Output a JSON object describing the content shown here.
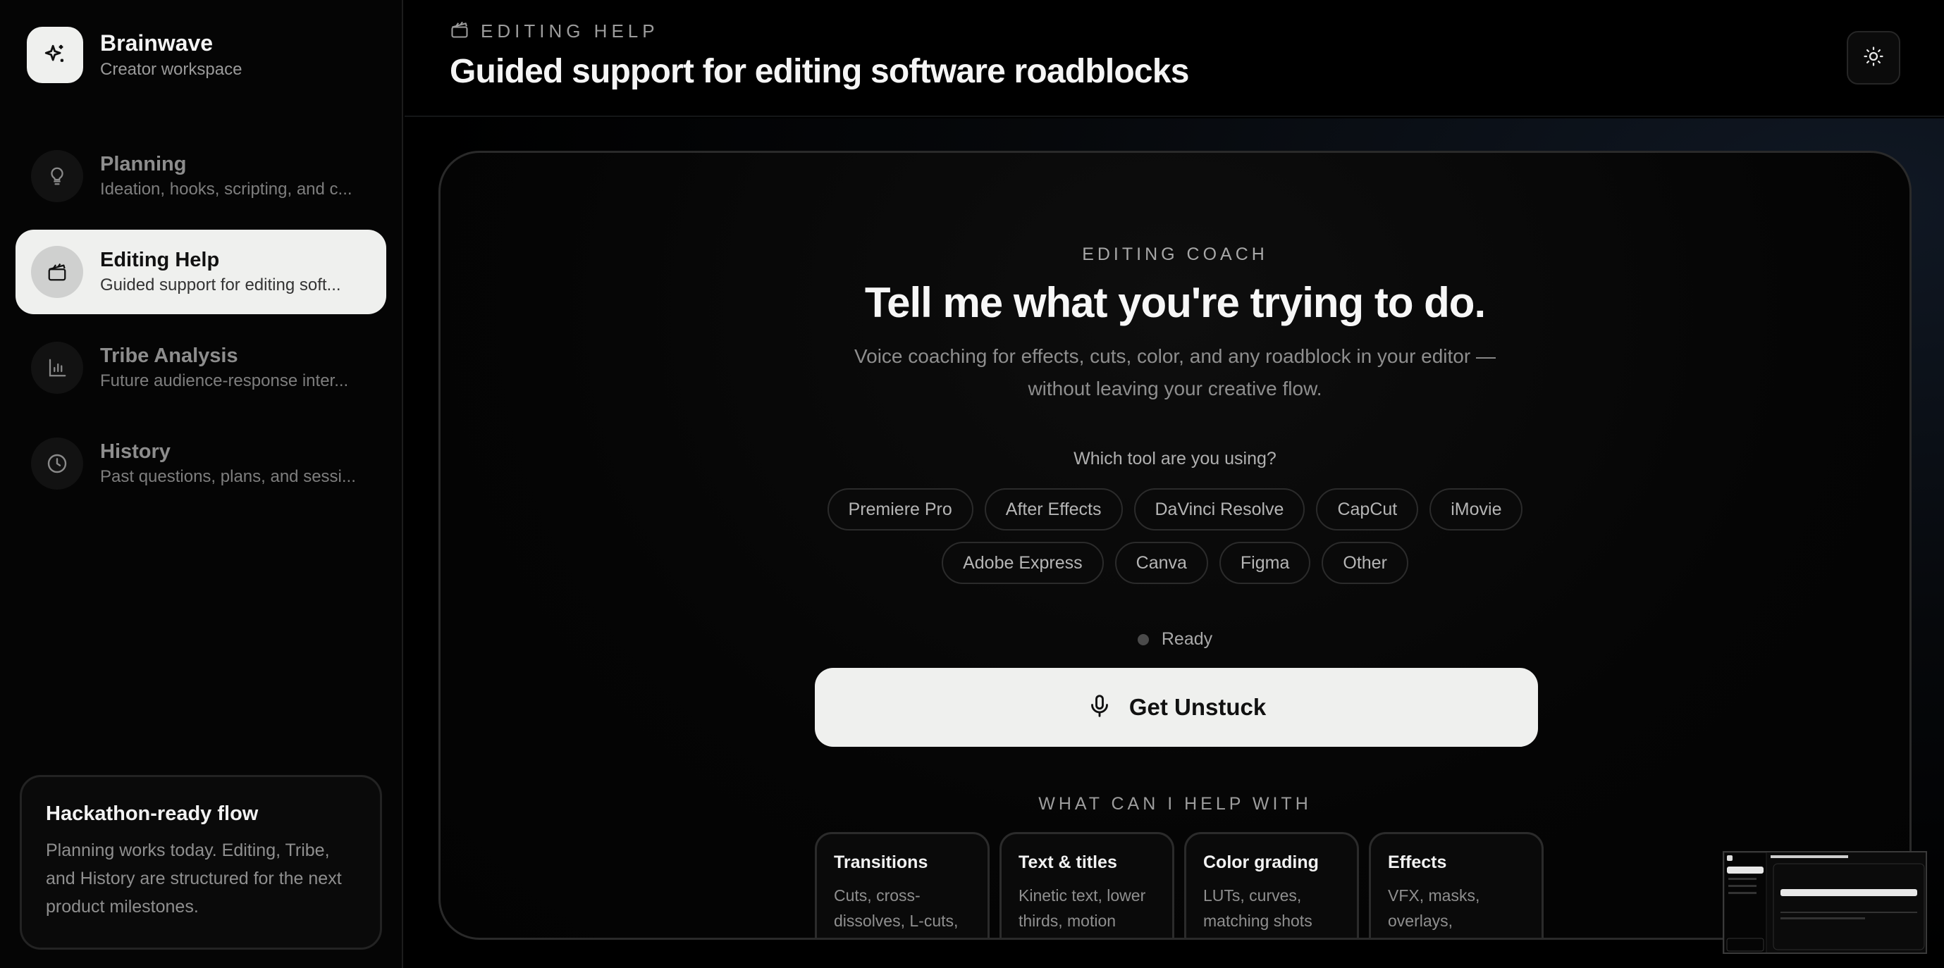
{
  "brand": {
    "name": "Brainwave",
    "subtitle": "Creator workspace",
    "logo_icon": "sparkles-icon"
  },
  "sidebar": {
    "items": [
      {
        "title": "Planning",
        "desc": "Ideation, hooks, scripting, and c...",
        "icon": "lightbulb-icon",
        "active": false
      },
      {
        "title": "Editing Help",
        "desc": "Guided support for editing soft...",
        "icon": "clapperboard-icon",
        "active": true
      },
      {
        "title": "Tribe Analysis",
        "desc": "Future audience-response inter...",
        "icon": "bar-chart-icon",
        "active": false
      },
      {
        "title": "History",
        "desc": "Past questions, plans, and sessi...",
        "icon": "clock-icon",
        "active": false
      }
    ],
    "card": {
      "title": "Hackathon-ready flow",
      "body": "Planning works today. Editing, Tribe, and History are structured for the next product milestones."
    }
  },
  "header": {
    "eyebrow": "EDITING HELP",
    "title": "Guided support for editing software roadblocks",
    "theme_icon": "sun-icon"
  },
  "coach": {
    "eyebrow": "EDITING COACH",
    "headline": "Tell me what you're trying to do.",
    "subcopy_line1": "Voice coaching for effects, cuts, color, and any roadblock in your editor —",
    "subcopy_line2": "without leaving your creative flow.",
    "tool_question": "Which tool are you using?",
    "tools_row1": [
      "Premiere Pro",
      "After Effects",
      "DaVinci Resolve",
      "CapCut",
      "iMovie"
    ],
    "tools_row2": [
      "Adobe Express",
      "Canva",
      "Figma",
      "Other"
    ],
    "status": "Ready",
    "cta_label": "Get Unstuck",
    "cta_icon": "microphone-icon",
    "help_heading": "WHAT CAN I HELP WITH",
    "help_cards": [
      {
        "title": "Transitions",
        "desc": "Cuts, cross-dissolves, L-cuts,"
      },
      {
        "title": "Text & titles",
        "desc": "Kinetic text, lower thirds, motion"
      },
      {
        "title": "Color grading",
        "desc": "LUTs, curves, matching shots"
      },
      {
        "title": "Effects",
        "desc": "VFX, masks, overlays,"
      }
    ]
  },
  "colors": {
    "accent_light": "#eff0ee",
    "background": "#000000",
    "muted_text": "#8e8e8e",
    "status_dot": "#4a4a4a"
  }
}
